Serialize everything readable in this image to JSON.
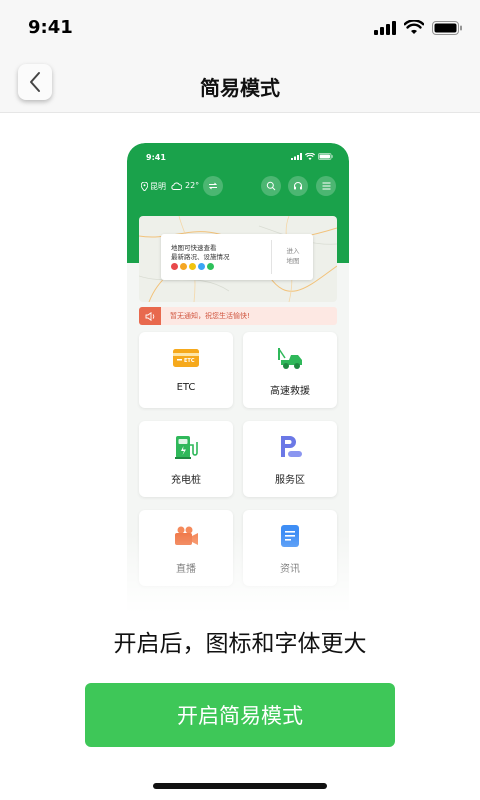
{
  "status_bar": {
    "time": "9:41"
  },
  "nav": {
    "title": "简易模式"
  },
  "preview": {
    "time": "9:41",
    "location": "昆明",
    "temperature": "22°",
    "map_card": {
      "line1": "地图可快速查看",
      "line2": "最新路况、设施情况",
      "enter_line1": "进入",
      "enter_line2": "地图",
      "dot_colors": [
        "#e8494b",
        "#f5a623",
        "#f1c40f",
        "#3ba5f5",
        "#2ec15b"
      ]
    },
    "notice": "暂无通知，祝您生活愉快!",
    "tiles": [
      {
        "label": "ETC",
        "icon": "etc-card-icon"
      },
      {
        "label": "高速救援",
        "icon": "tow-truck-icon"
      },
      {
        "label": "充电桩",
        "icon": "charging-pile-icon"
      },
      {
        "label": "服务区",
        "icon": "service-area-icon"
      },
      {
        "label": "直播",
        "icon": "video-camera-icon"
      },
      {
        "label": "资讯",
        "icon": "news-document-icon"
      }
    ],
    "colors": {
      "header": "#1aa24b",
      "notice_tag": "#e8694e"
    }
  },
  "caption": "开启后，图标和字体更大",
  "button": {
    "label": "开启简易模式",
    "color": "#3ec758"
  }
}
